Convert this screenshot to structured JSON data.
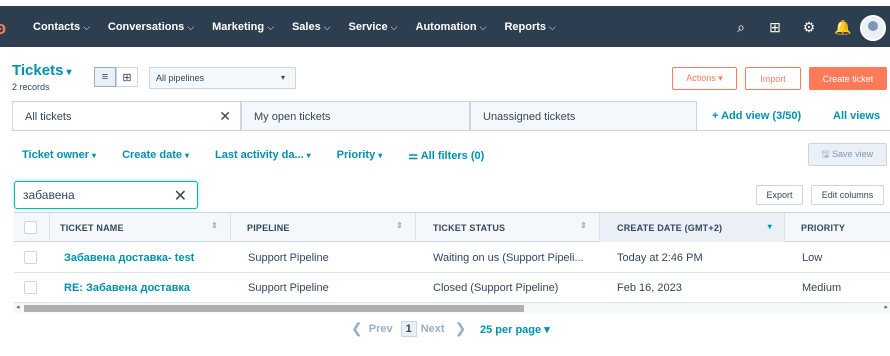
{
  "nav": {
    "logo": "ʚ",
    "items": [
      {
        "label": "Contacts"
      },
      {
        "label": "Conversations"
      },
      {
        "label": "Marketing"
      },
      {
        "label": "Sales"
      },
      {
        "label": "Service"
      },
      {
        "label": "Automation"
      },
      {
        "label": "Reports"
      }
    ],
    "chev": "⌵",
    "icons": {
      "search": "⌕",
      "marketplace": "⊞",
      "settings": "⚙",
      "notifications": "🔔"
    }
  },
  "header": {
    "title": "Tickets",
    "title_caret": "▾",
    "records": "2 records",
    "list_icon": "≡",
    "grid_icon": "⊞",
    "pipeline": "All pipelines",
    "pipeline_caret": "▾",
    "actions": "Actions ▾",
    "import": "Import",
    "create": "Create ticket"
  },
  "tabs": {
    "items": [
      "All tickets",
      "My open tickets",
      "Unassigned tickets"
    ],
    "close": "✕",
    "add_view": "+ Add view (3/50)",
    "all_views": "All views"
  },
  "filters": {
    "items": [
      "Ticket owner",
      "Create date",
      "Last activity da...",
      "Priority"
    ],
    "caret": "▾",
    "all_filters": "⚌ All filters (0)",
    "save_view": "🖫 Save view"
  },
  "search": {
    "value": "забавена",
    "clear": "✕",
    "export": "Export",
    "edit_columns": "Edit columns"
  },
  "table": {
    "headers": [
      "TICKET NAME",
      "PIPELINE",
      "TICKET STATUS",
      "CREATE DATE (GMT+2)",
      "PRIORITY"
    ],
    "sort_icon": "⇕",
    "sort_active": "▾",
    "rows": [
      {
        "name": "Забавена доставка- test",
        "pipeline": "Support Pipeline",
        "status": "Waiting on us (Support Pipeli...",
        "date": "Today at 2:46 PM",
        "priority": "Low"
      },
      {
        "name": "RE: Забавена доставка",
        "pipeline": "Support Pipeline",
        "status": "Closed (Support Pipeline)",
        "date": "Feb 16, 2023",
        "priority": "Medium"
      }
    ]
  },
  "scrollbar": {
    "left": "◂",
    "right": "▸"
  },
  "pager": {
    "prev_arrow": "❮",
    "prev": "Prev",
    "page": "1",
    "next": "Next",
    "next_arrow": "❯",
    "per_page": "25 per page ▾"
  }
}
